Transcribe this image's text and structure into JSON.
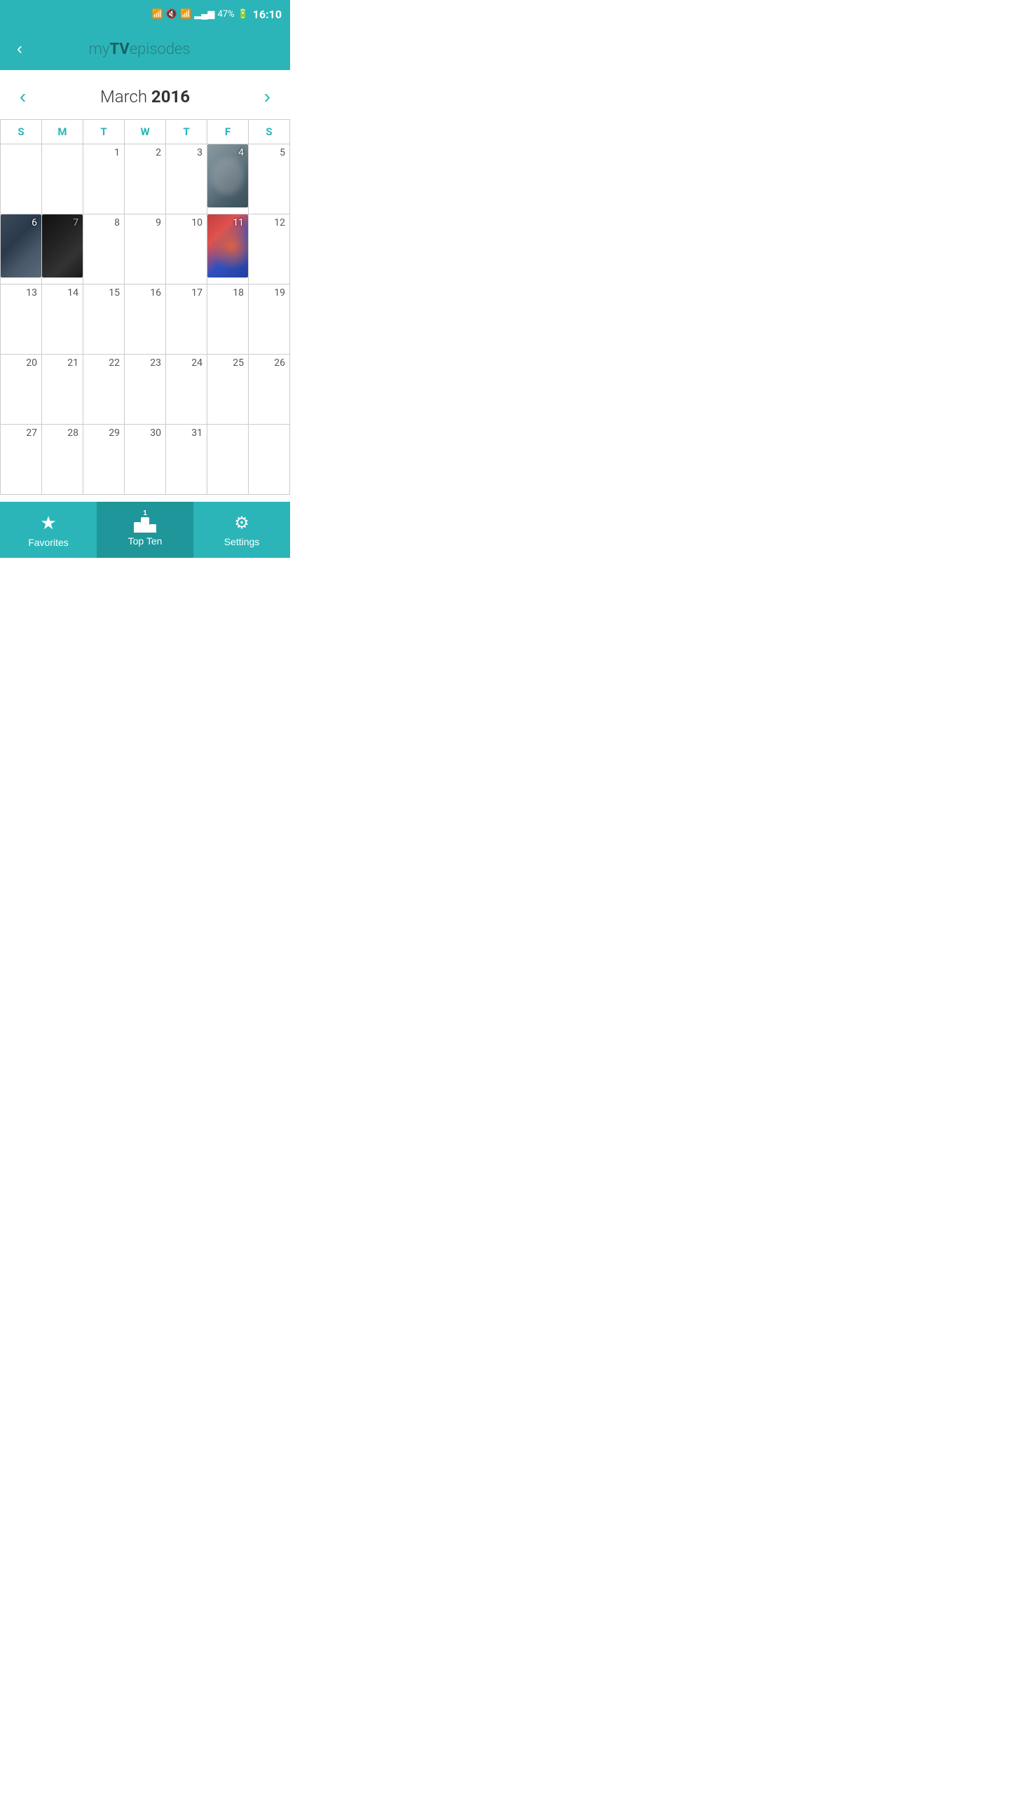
{
  "statusBar": {
    "time": "16:10",
    "battery": "47%",
    "icons": [
      "bluetooth",
      "mute",
      "wifi",
      "signal",
      "battery"
    ]
  },
  "header": {
    "backLabel": "‹",
    "titleMy": "my",
    "titleTV": "TV",
    "titleEpisodes": "episodes"
  },
  "calendar": {
    "prevBtn": "‹",
    "nextBtn": "›",
    "monthLabel": "March",
    "yearLabel": "2016",
    "weekdays": [
      "S",
      "M",
      "T",
      "W",
      "T",
      "F",
      "S"
    ],
    "weeks": [
      [
        "",
        "",
        "1",
        "2",
        "3",
        "4",
        "5"
      ],
      [
        "6",
        "7",
        "8",
        "9",
        "10",
        "11",
        "12"
      ],
      [
        "13",
        "14",
        "15",
        "16",
        "17",
        "18",
        "19"
      ],
      [
        "20",
        "21",
        "22",
        "23",
        "24",
        "25",
        "26"
      ],
      [
        "27",
        "28",
        "29",
        "30",
        "31",
        "",
        ""
      ]
    ]
  },
  "bottomNav": {
    "items": [
      {
        "id": "favorites",
        "label": "Favorites",
        "icon": "star"
      },
      {
        "id": "topten",
        "label": "Top Ten",
        "icon": "podium"
      },
      {
        "id": "settings",
        "label": "Settings",
        "icon": "gear"
      }
    ]
  },
  "accent": "#2bb5b8"
}
